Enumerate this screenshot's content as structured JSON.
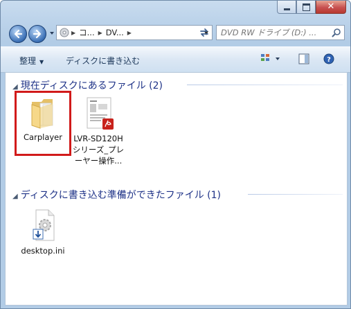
{
  "window": {
    "caption_buttons": [
      "minimize",
      "maximize",
      "close"
    ]
  },
  "nav": {
    "back_icon": "back-arrow-icon",
    "forward_icon": "forward-arrow-icon",
    "address": {
      "crumbs": [
        "コ...",
        "DV..."
      ],
      "icon": "drive-icon"
    },
    "search_placeholder": "DVD RW ドライブ (D:) ...",
    "search_icon": "magnifier-icon"
  },
  "toolbar": {
    "organize_label": "整理",
    "burn_label": "ディスクに書き込む",
    "view_icon": "view-options-icon",
    "preview_icon": "preview-pane-icon",
    "help_icon": "help-icon"
  },
  "groups": [
    {
      "title": "現在ディスクにあるファイル (2)",
      "items": [
        {
          "label": "Carplayer",
          "icon": "folder-icon",
          "selected": true
        },
        {
          "label": "LVR-SD120Hシリーズ_プレーヤー操作...",
          "icon": "pdf-document-icon"
        }
      ]
    },
    {
      "title": "ディスクに書き込む準備ができたファイル (1)",
      "items": [
        {
          "label": "desktop.ini",
          "icon": "settings-file-pending-icon"
        }
      ]
    }
  ],
  "colors": {
    "accent_selection": "#d11a1a",
    "group_header_text": "#1e3287",
    "chrome_blue": "#b2cce6"
  }
}
